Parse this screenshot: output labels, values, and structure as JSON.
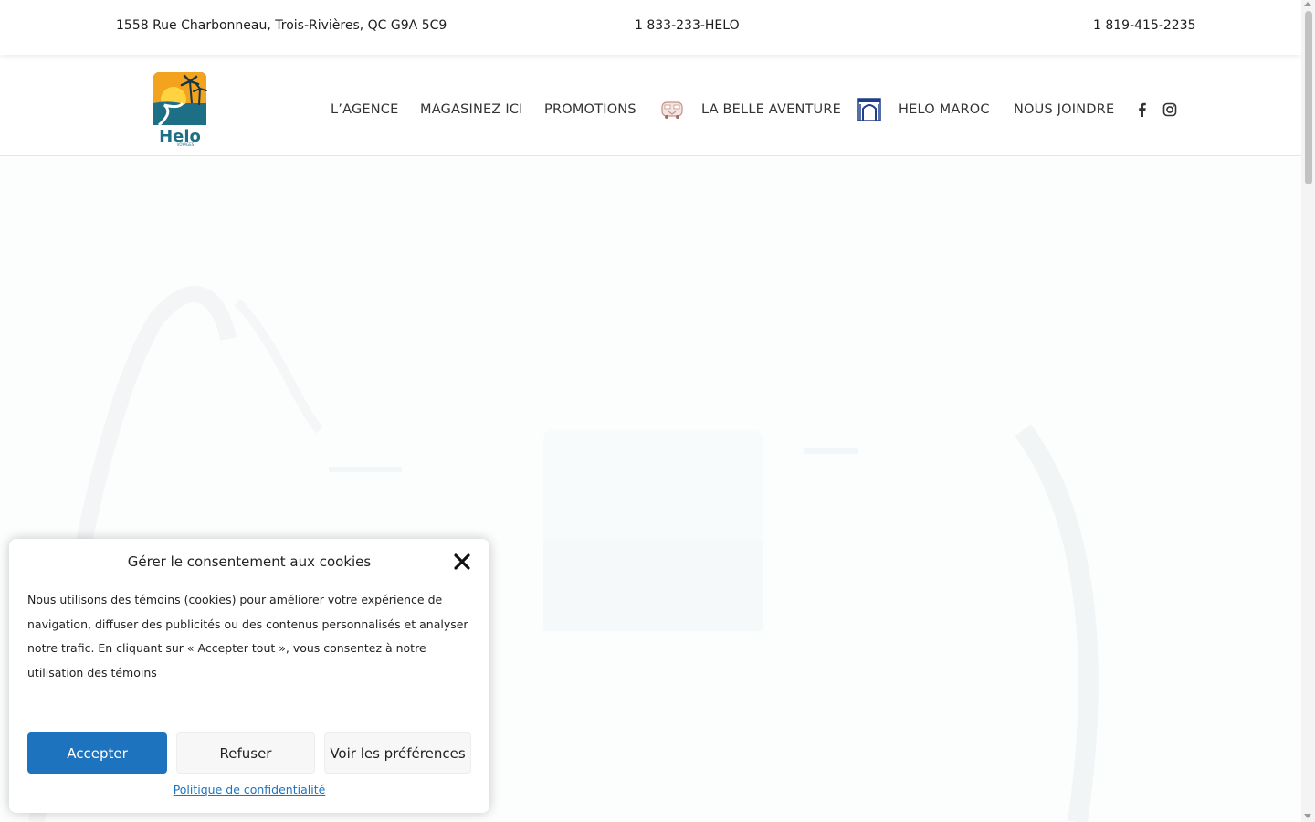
{
  "topbar": {
    "address": "1558 Rue Charbonneau, Trois-Rivières, QC  G9A 5C9",
    "phone_toll_free": "1 833-233-HELO",
    "phone_local": "1 819-415-2235"
  },
  "logo": {
    "text": "Helo",
    "subtext": "VOYAGES"
  },
  "nav": {
    "items": [
      {
        "label": "L’AGENCE"
      },
      {
        "label": "MAGASINEZ ICI"
      },
      {
        "label": "PROMOTIONS"
      },
      {
        "label": "LA BELLE AVENTURE",
        "icon": "van-icon"
      },
      {
        "label": "HELO MAROC",
        "icon": "arch-icon"
      },
      {
        "label": "NOUS JOINDRE"
      }
    ],
    "social": [
      "facebook-icon",
      "instagram-icon"
    ]
  },
  "cookie_banner": {
    "title": "Gérer le consentement aux cookies",
    "body": "Nous utilisons des témoins (cookies) pour améliorer votre expérience de navigation, diffuser des publicités ou des contenus personnalisés et analyser notre trafic. En cliquant sur « Accepter tout », vous consentez à notre utilisation des témoins",
    "accept_label": "Accepter",
    "refuse_label": "Refuser",
    "preferences_label": "Voir les préférences",
    "policy_link": "Politique de confidentialité"
  },
  "colors": {
    "accent": "#1e73be",
    "logo_teal": "#1d6f86",
    "logo_orange": "#f3a31d",
    "maroc_blue": "#1f3f8a"
  }
}
